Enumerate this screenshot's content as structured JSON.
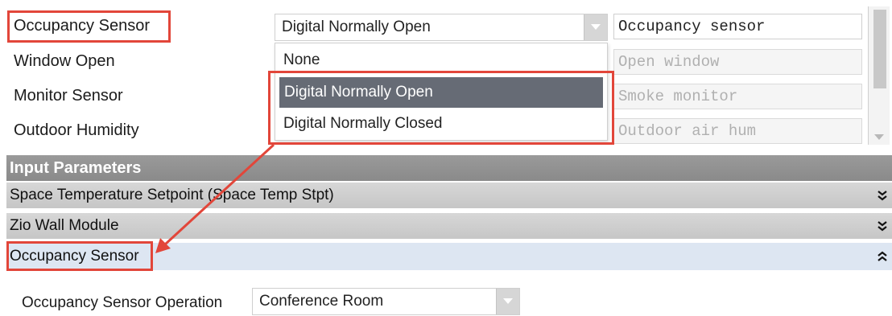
{
  "config_rows": [
    {
      "label": "Occupancy Sensor",
      "field_value": "Occupancy sensor",
      "field_disabled": false
    },
    {
      "label": "Window Open",
      "field_value": "Open window",
      "field_disabled": true
    },
    {
      "label": "Monitor Sensor",
      "field_value": "Smoke monitor",
      "field_disabled": true
    },
    {
      "label": "Outdoor Humidity",
      "field_value": "Outdoor air hum",
      "field_disabled": true
    }
  ],
  "sensor_type_select": {
    "value": "Digital Normally Open"
  },
  "dropdown": {
    "options": [
      "None",
      "Digital Normally Open",
      "Digital Normally Closed"
    ],
    "selected_index": 1
  },
  "sections": {
    "header": "Input Parameters",
    "groups": [
      {
        "label": "Space Temperature Setpoint (Space Temp Stpt)",
        "expanded": false
      },
      {
        "label": "Zio Wall Module",
        "expanded": false
      },
      {
        "label": "Occupancy Sensor",
        "expanded": true
      }
    ]
  },
  "occupancy_operation": {
    "label": "Occupancy Sensor Operation",
    "value": "Conference Room"
  },
  "colors": {
    "highlight": "#e2463a",
    "selected_option_bg": "#666b75",
    "expanded_bg": "#dde6f2"
  }
}
